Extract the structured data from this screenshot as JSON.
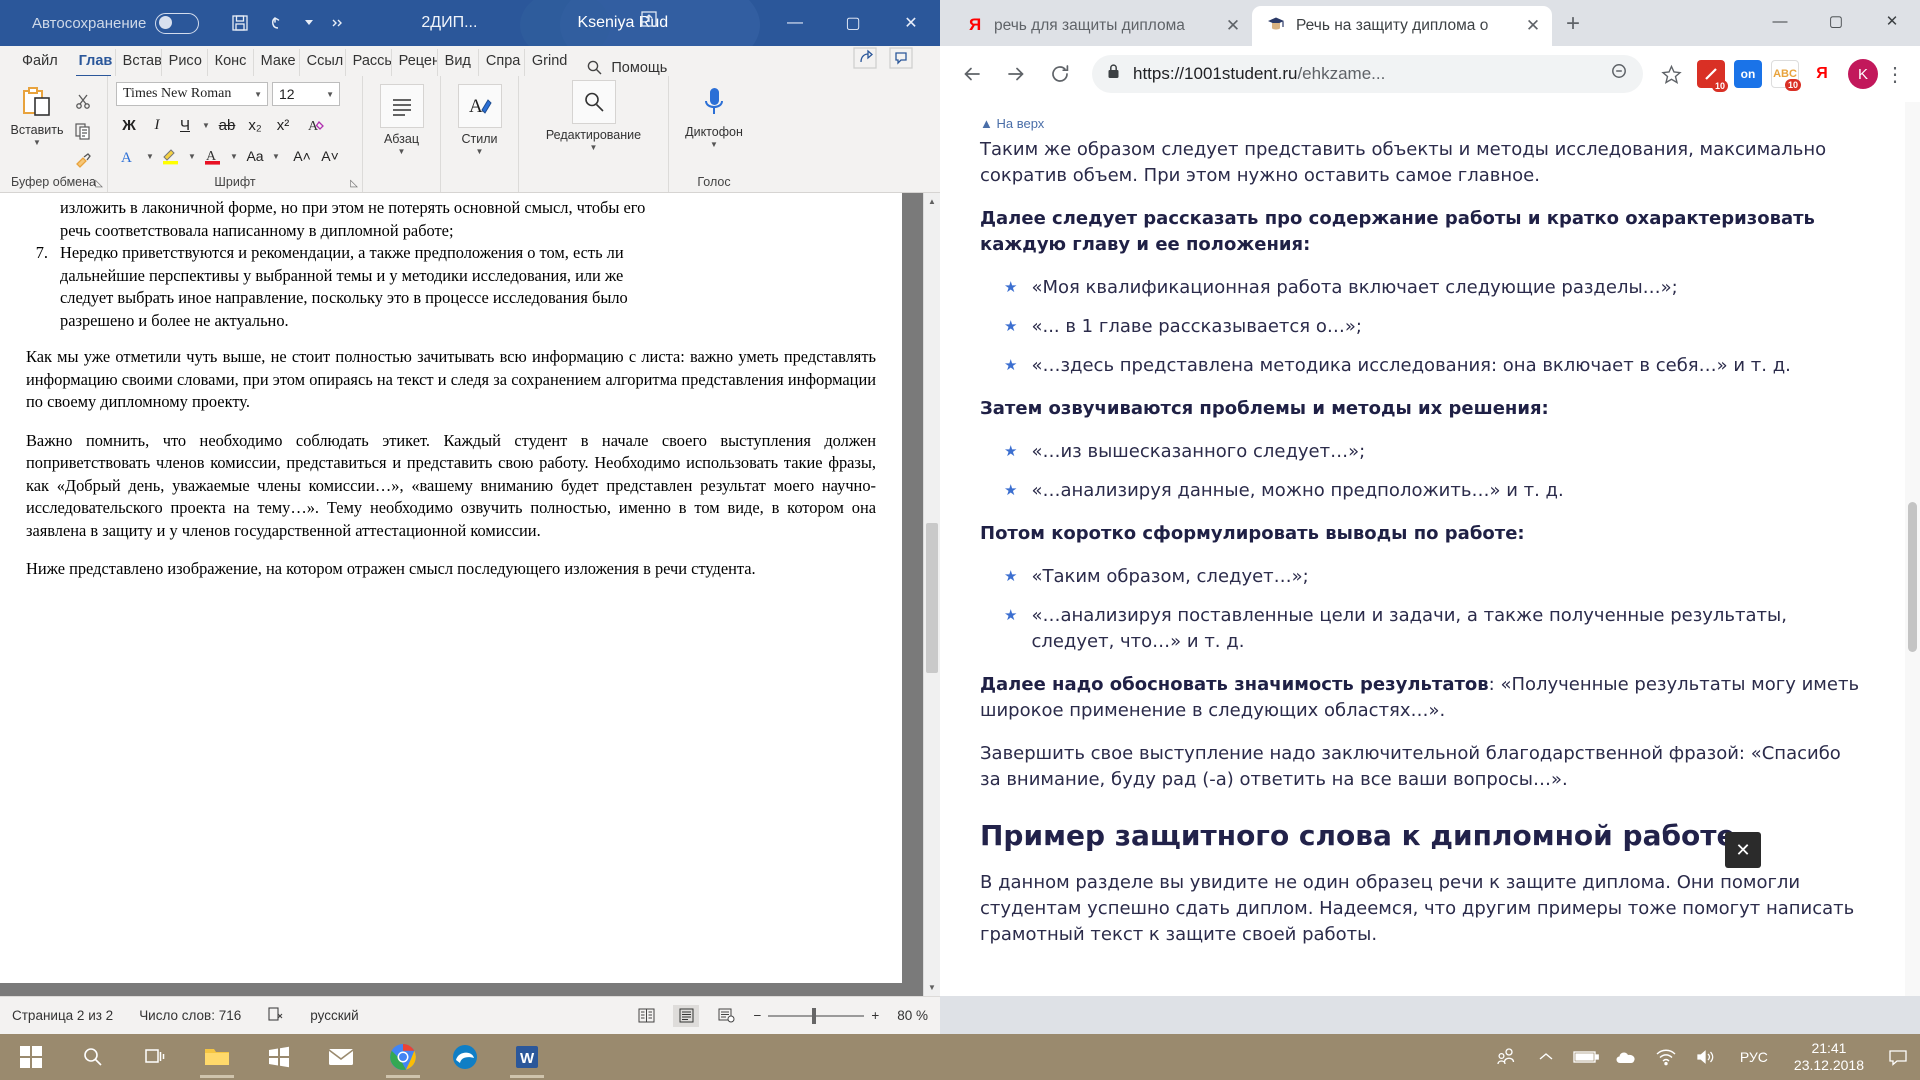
{
  "word": {
    "titlebar": {
      "autosave_label": "Автосохранение",
      "autosave_state": "off",
      "doc_name": "2ДИП...",
      "user_name": "Kseniya Rud",
      "save_icon": "save-icon",
      "undo_icon": "undo-icon",
      "more_icon": "more-icon",
      "share_icon": "share-icon",
      "minimize": "—",
      "maximize": "▢",
      "close": "✕"
    },
    "tabs": [
      {
        "label": "Файл",
        "active": false
      },
      {
        "label": "Глав",
        "active": true
      },
      {
        "label": "Встав",
        "active": false
      },
      {
        "label": "Рисо",
        "active": false
      },
      {
        "label": "Конс",
        "active": false
      },
      {
        "label": "Маке",
        "active": false
      },
      {
        "label": "Ссыл",
        "active": false
      },
      {
        "label": "Рассь",
        "active": false
      },
      {
        "label": "Рецен",
        "active": false
      },
      {
        "label": "Вид",
        "active": false
      },
      {
        "label": "Спра",
        "active": false
      },
      {
        "label": "Grind",
        "active": false
      }
    ],
    "help_label": "Помощь",
    "ribbon": {
      "clipboard": {
        "group_label": "Буфер обмена",
        "paste_label": "Вставить",
        "cut_icon": "scissors-icon",
        "copy_icon": "copy-icon",
        "format_painter_icon": "format-painter-icon",
        "dialog_launcher": "◺"
      },
      "font": {
        "group_label": "Шрифт",
        "font_family": "Times New Roman",
        "font_size": "12",
        "bold": "Ж",
        "italic": "I",
        "underline": "Ч",
        "strikethrough": "ab",
        "subscript": "x₂",
        "superscript": "x²",
        "clear_format_icon": "clear-formatting-icon",
        "text_effects_icon": "text-effects-icon",
        "highlight_icon": "highlight-icon",
        "font_color_icon": "font-color-icon",
        "change_case": "Aa",
        "grow_font": "A˄",
        "shrink_font": "A˅",
        "dialog_launcher": "◺"
      },
      "paragraph": {
        "label": "Абзац",
        "icon": "paragraph-icon"
      },
      "styles": {
        "label": "Стили",
        "icon": "styles-icon"
      },
      "editing": {
        "label": "Редактирование",
        "icon": "search-icon"
      },
      "voice": {
        "label": "Диктофон",
        "group_label": "Голос",
        "icon": "microphone-icon"
      }
    },
    "document": {
      "list_items": [
        {
          "number": "",
          "lines": [
            "изложить в лаконичной форме, но при этом не потерять основной смысл, чтобы его",
            "речь соответствовала написанному в дипломной работе;"
          ]
        },
        {
          "number": "7.",
          "lines": [
            "Нередко приветствуются и рекомендации, а также предположения о том, есть ли",
            "дальнейшие перспективы у выбранной темы и у методики исследования, или же",
            "следует выбрать иное направление, поскольку это в процессе исследования было",
            "разрешено и более не актуально."
          ]
        }
      ],
      "paragraphs": [
        "Как мы уже отметили чуть выше, не стоит полностью зачитывать всю информацию с листа: важно уметь представлять информацию своими словами, при этом опираясь на текст и следя за сохранением алгоритма представления информации по своему дипломному проекту.",
        "Важно помнить, что необходимо соблюдать этикет. Каждый студент в начале своего выступления должен поприветствовать членов комиссии, представиться и представить свою работу. Необходимо использовать такие фразы, как «Добрый день, уважаемые члены комиссии…», «вашему вниманию будет представлен результат моего научно-исследовательского проекта на тему…». Тему необходимо озвучить полностью, именно в том виде, в котором она заявлена в защиту и у членов государственной аттестационной комиссии.",
        "Ниже представлено изображение, на котором отражен смысл последующего изложения в речи студента."
      ]
    },
    "status": {
      "page": "Страница 2 из 2",
      "words": "Число слов: 716",
      "proofing_icon": "proofing-errors-icon",
      "language": "русский",
      "view_read_icon": "read-mode-icon",
      "view_print_icon": "print-layout-icon",
      "view_web_icon": "web-layout-icon",
      "zoom_out": "−",
      "zoom_in": "+",
      "zoom_value": "80 %"
    }
  },
  "chrome": {
    "tabs": [
      {
        "label": "речь для защиты диплома",
        "favicon": "yandex-icon",
        "active": false,
        "close": "✕"
      },
      {
        "label": "Речь на защиту диплома о",
        "favicon": "graduation-cap-icon",
        "active": true,
        "close": "✕"
      }
    ],
    "new_tab": "+",
    "window_controls": {
      "minimize": "—",
      "maximize": "▢",
      "close": "✕"
    },
    "toolbar": {
      "back_icon": "back-arrow-icon",
      "forward_icon": "forward-arrow-icon",
      "reload_icon": "reload-icon",
      "lock_icon": "lock-icon",
      "url_secure": "https://",
      "url_host": "1001student.ru",
      "url_path": "/ehkzame...",
      "zoom_icon": "zoom-out-icon",
      "bookmark_icon": "star-icon",
      "kebab_icon": "more-vertical-icon"
    },
    "extensions": [
      {
        "name": "adblock-extension-icon",
        "label": "",
        "badge": "10",
        "color": "#d93025"
      },
      {
        "name": "on-extension-icon",
        "label": "on",
        "badge": "",
        "color": "#1a73e8"
      },
      {
        "name": "abc-spellcheck-extension-icon",
        "label": "ABC",
        "badge": "10",
        "color": "#e8a33d"
      },
      {
        "name": "yandex-extension-icon",
        "label": "Я",
        "badge": "",
        "color": "#ffffff"
      }
    ],
    "profile": {
      "name": "profile-avatar",
      "initial": "K"
    },
    "page": {
      "breadcrumb": "На верх",
      "blocks": [
        {
          "type": "p",
          "text": "Таким же образом следует представить объекты и методы исследования, максимально сократив объем. При этом нужно оставить самое главное."
        },
        {
          "type": "p-bold",
          "text": "Далее следует рассказать про содержание работы и кратко охарактеризовать каждую главу и ее положения:"
        },
        {
          "type": "ul",
          "items": [
            "«Моя квалификационная работа включает следующие разделы…»;",
            "«... в 1 главе рассказывается о…»;",
            "«…здесь представлена методика исследования: она включает в себя…» и т. д."
          ]
        },
        {
          "type": "p-bold",
          "text": "Затем озвучиваются проблемы и методы их решения:"
        },
        {
          "type": "ul",
          "items": [
            "«…из вышесказанного следует…»;",
            "«…анализируя данные, можно предположить…» и т. д."
          ]
        },
        {
          "type": "p-bold",
          "text": "Потом коротко сформулировать выводы по работе:"
        },
        {
          "type": "ul",
          "items": [
            "«Таким образом, следует…»;",
            "«…анализируя поставленные цели и задачи, а также полученные результаты, следует, что…» и т. д."
          ]
        },
        {
          "type": "p-mixed",
          "bold": "Далее надо обосновать значимость результатов",
          "text": ": «Полученные результаты могу иметь широкое применение в следующих областях…»."
        },
        {
          "type": "p",
          "text": "Завершить свое выступление надо заключительной благодарственной фразой: «Спасибо за внимание, буду рад (-а) ответить на все ваши вопросы…»."
        },
        {
          "type": "h2",
          "text": "Пример защитного слова к дипломной работе"
        },
        {
          "type": "p",
          "text": "В данном разделе вы увидите не один образец речи к защите диплома. Они помогли студентам успешно сдать диплом. Надеемся, что другим примеры тоже помогут написать грамотный текст к защите своей работы."
        }
      ],
      "close_overlay": "✕"
    }
  },
  "taskbar": {
    "start_icon": "windows-start-icon",
    "search_icon": "search-icon",
    "taskview_icon": "task-view-icon",
    "apps": [
      {
        "name": "file-explorer-icon",
        "running": true
      },
      {
        "name": "microsoft-store-icon",
        "running": false
      },
      {
        "name": "mail-icon",
        "running": false
      },
      {
        "name": "chrome-icon",
        "running": true
      },
      {
        "name": "edge-icon",
        "running": false
      },
      {
        "name": "word-icon",
        "running": true
      }
    ],
    "tray": {
      "people_icon": "people-icon",
      "overflow_icon": "chevron-up-icon",
      "battery_icon": "battery-icon",
      "onedrive_icon": "cloud-icon",
      "wifi_icon": "wifi-icon",
      "volume_icon": "speaker-icon",
      "language": "РУС",
      "time": "21:41",
      "date": "23.12.2018",
      "notifications_icon": "notification-icon"
    }
  }
}
